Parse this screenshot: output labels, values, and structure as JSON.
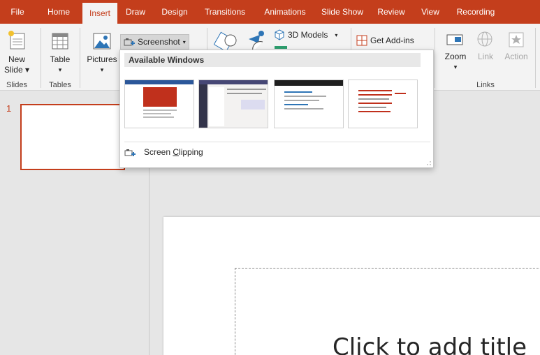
{
  "tabs": [
    "File",
    "Home",
    "Insert",
    "Draw",
    "Design",
    "Transitions",
    "Animations",
    "Slide Show",
    "Review",
    "View",
    "Recording"
  ],
  "active_tab": "Insert",
  "ribbon": {
    "new_slide": {
      "line1": "New",
      "line2": "Slide"
    },
    "table": "Table",
    "pictures": "Pictures",
    "screenshot": "Screenshot",
    "models_3d": "3D Models",
    "get_addins": "Get Add-ins",
    "zoom": "Zoom",
    "link": "Link",
    "action": "Action",
    "groups": {
      "slides": "Slides",
      "tables": "Tables",
      "links": "Links"
    }
  },
  "dropdown": {
    "header": "Available Windows",
    "screen_clipping": {
      "before": "Screen ",
      "accel": "C",
      "after": "lipping"
    }
  },
  "slide_pane": {
    "slide_number": "1"
  },
  "slide": {
    "title_placeholder": "Click to add title"
  },
  "colors": {
    "accent": "#c43e1c",
    "ribbon_bg": "#f3f3f3",
    "canvas_bg": "#e6e6e6"
  }
}
